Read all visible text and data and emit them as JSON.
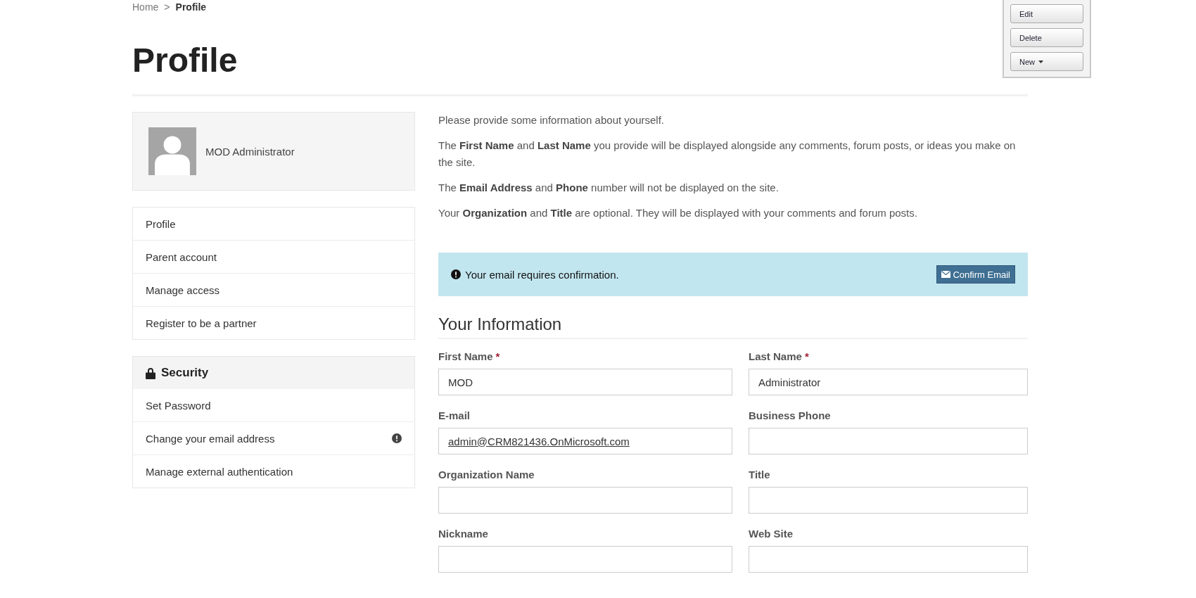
{
  "breadcrumb": [
    {
      "label": "Home",
      "current": false
    },
    {
      "label": "Profile",
      "current": true
    }
  ],
  "breadcrumb_separator": ">",
  "page_title": "Profile",
  "toolbar": {
    "buttons": [
      {
        "label": "Edit",
        "dropdown": false
      },
      {
        "label": "Delete",
        "dropdown": false
      },
      {
        "label": "New",
        "dropdown": true
      }
    ]
  },
  "profile_card": {
    "name": "MOD Administrator"
  },
  "nav": {
    "items": [
      {
        "label": "Profile"
      },
      {
        "label": "Parent account"
      },
      {
        "label": "Manage access"
      },
      {
        "label": "Register to be a partner"
      }
    ]
  },
  "security": {
    "title": "Security",
    "items": [
      {
        "label": "Set Password",
        "alert": false
      },
      {
        "label": "Change your email address",
        "alert": true
      },
      {
        "label": "Manage external authentication",
        "alert": false
      }
    ]
  },
  "intro": [
    "Please provide some information about yourself.",
    "The **First Name** and **Last Name** you provide will be displayed alongside any comments, forum posts, or ideas you make on the site.",
    "The **Email Address** and **Phone** number will not be displayed on the site.",
    "Your **Organization** and **Title** are optional. They will be displayed with your comments and forum posts."
  ],
  "alert": {
    "message": "Your email requires confirmation.",
    "button": "Confirm Email"
  },
  "section_title": "Your Information",
  "fields": [
    {
      "label": "First Name",
      "required_mark": "*",
      "value": "MOD",
      "kind": "text"
    },
    {
      "label": "Last Name",
      "required_mark": "*",
      "value": "Administrator",
      "kind": "text"
    },
    {
      "label": "E-mail",
      "value": "admin@CRM821436.OnMicrosoft.com",
      "kind": "link"
    },
    {
      "label": "Business Phone",
      "kind": "text"
    },
    {
      "label": "Organization Name",
      "kind": "text"
    },
    {
      "label": "Title",
      "kind": "text"
    },
    {
      "label": "Nickname",
      "kind": "text"
    },
    {
      "label": "Web Site",
      "kind": "text"
    }
  ]
}
